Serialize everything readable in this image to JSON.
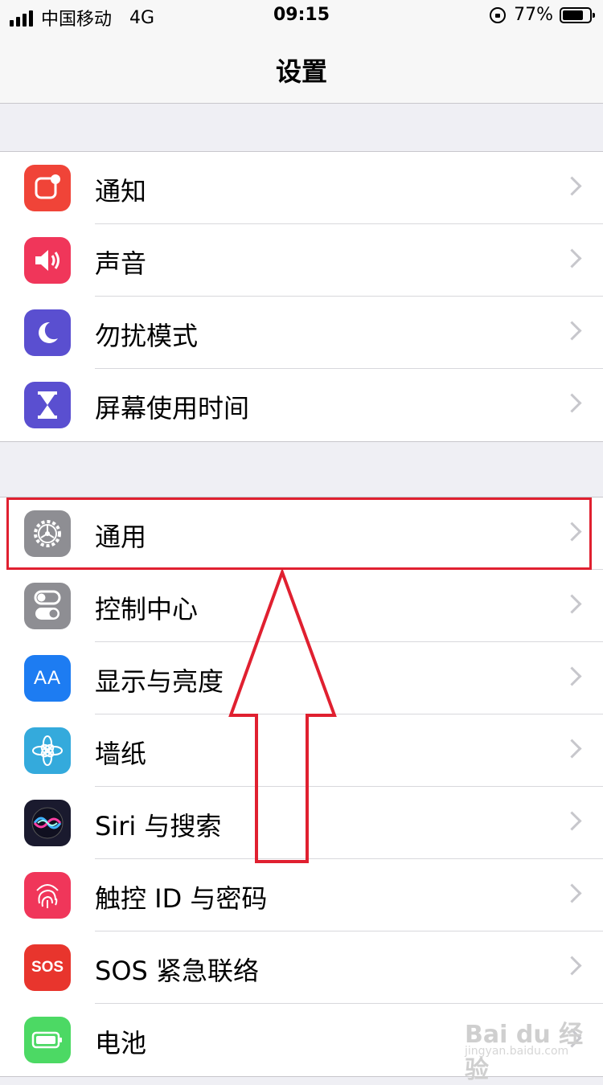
{
  "status_bar": {
    "carrier": "中国移动",
    "network": "4G",
    "time": "09:15",
    "battery_percent_text": "77%",
    "battery_level": 0.77
  },
  "nav": {
    "title": "设置"
  },
  "groups": [
    {
      "items": [
        {
          "label": "通知",
          "icon": "notifications-icon",
          "color": "#f04438"
        },
        {
          "label": "声音",
          "icon": "sounds-icon",
          "color": "#f0365a"
        },
        {
          "label": "勿扰模式",
          "icon": "do-not-disturb-moon-icon",
          "color": "#5a4fd0"
        },
        {
          "label": "屏幕使用时间",
          "icon": "screen-time-hourglass-icon",
          "color": "#5a4fd0"
        }
      ]
    },
    {
      "items": [
        {
          "label": "通用",
          "icon": "general-gear-icon",
          "color": "#8e8e93"
        },
        {
          "label": "控制中心",
          "icon": "control-center-toggles-icon",
          "color": "#8e8e93"
        },
        {
          "label": "显示与亮度",
          "icon": "display-brightness-aa-icon",
          "color": "#1d7cf2",
          "glyph": "AA"
        },
        {
          "label": "墙纸",
          "icon": "wallpaper-flower-icon",
          "color": "#34aadc"
        },
        {
          "label": "Siri 与搜索",
          "icon": "siri-icon",
          "color": "#1a1a2e"
        },
        {
          "label": "触控 ID 与密码",
          "icon": "touch-id-fingerprint-icon",
          "color": "#f0365a"
        },
        {
          "label": "SOS 紧急联络",
          "icon": "sos-icon",
          "color": "#e8352d",
          "glyph": "SOS"
        },
        {
          "label": "电池",
          "icon": "battery-icon",
          "color": "#4cd964"
        }
      ]
    }
  ],
  "watermark": {
    "text": "Bai du 经验",
    "sub": "jingyan.baidu.com"
  },
  "annotation": {
    "highlight_color": "#e02030"
  }
}
